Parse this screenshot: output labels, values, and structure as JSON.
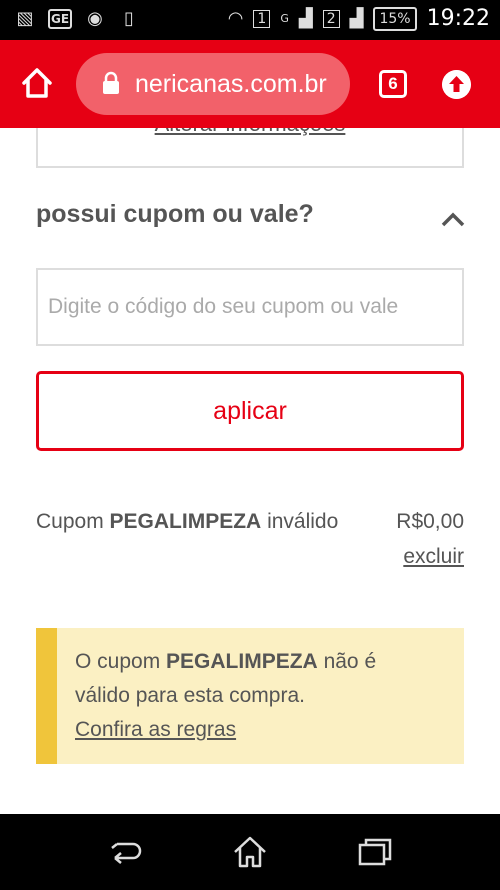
{
  "status_bar": {
    "time": "19:22",
    "battery": "15%",
    "sim1": "1",
    "sim2": "2",
    "network": "G",
    "notifications": [
      "gallery-icon",
      "ge-icon",
      "music-icon",
      "phone-icon"
    ]
  },
  "browser": {
    "url": "nericanas.com.br",
    "tab_count": "6"
  },
  "page": {
    "alter_link": "Alterar informações",
    "coupon_heading": "possui cupom ou vale?",
    "coupon_input": {
      "placeholder": "Digite o código do seu cupom ou vale",
      "value": ""
    },
    "apply_label": "aplicar",
    "coupon_status": {
      "prefix": "Cupom",
      "code": "PEGALIMPEZA",
      "suffix": "inválido",
      "value": "R$0,00",
      "remove_label": "excluir"
    },
    "alert": {
      "prefix": "O cupom",
      "code": "PEGALIMPEZA",
      "suffix": "não é válido para esta compra.",
      "link": "Confira as regras"
    }
  },
  "colors": {
    "brand_red": "#e60014",
    "alert_bg": "#fbf0c3",
    "alert_bar": "#f0c53b"
  }
}
